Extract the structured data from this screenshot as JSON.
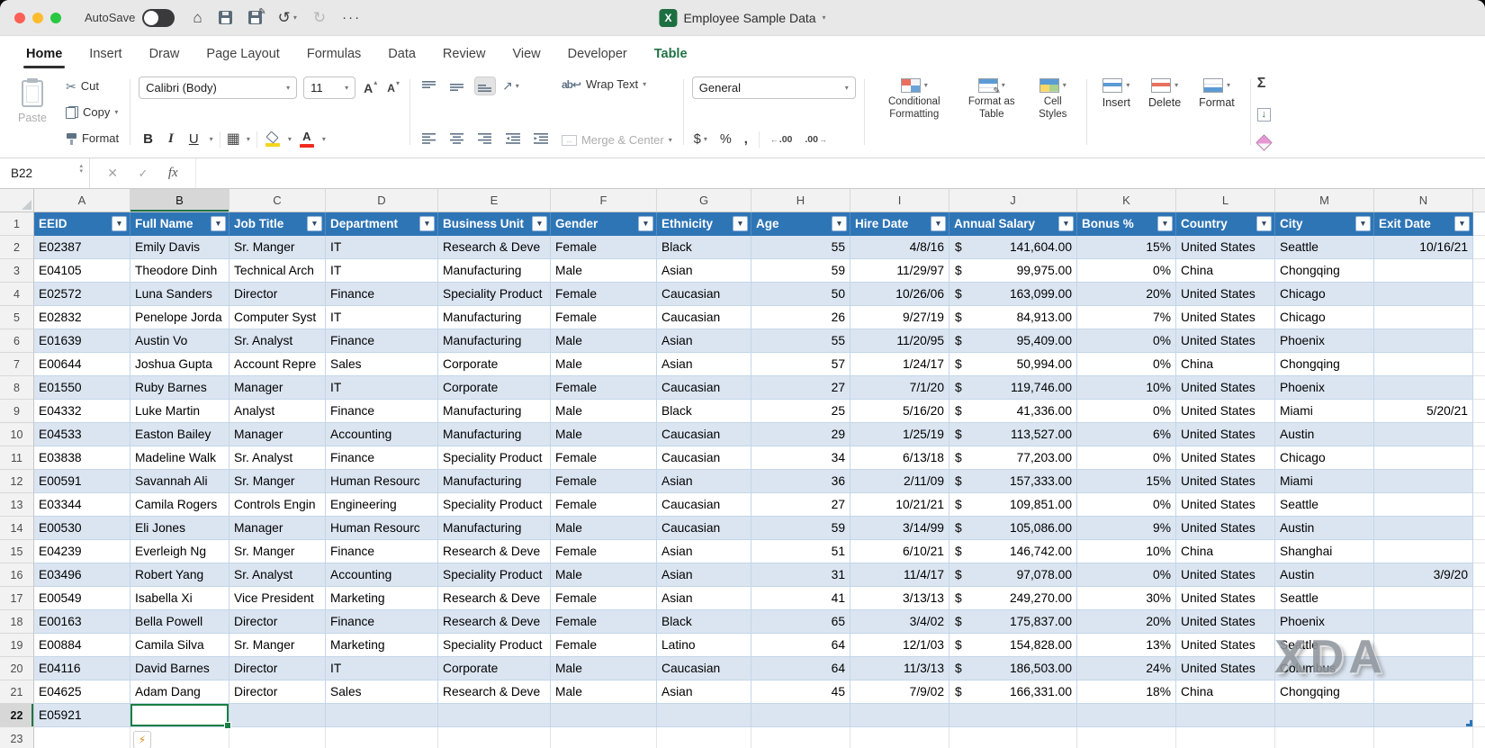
{
  "titlebar": {
    "autosave_label": "AutoSave",
    "doc_title": "Employee Sample Data"
  },
  "tabs": [
    {
      "label": "Home",
      "active": true
    },
    {
      "label": "Insert"
    },
    {
      "label": "Draw"
    },
    {
      "label": "Page Layout"
    },
    {
      "label": "Formulas"
    },
    {
      "label": "Data"
    },
    {
      "label": "Review"
    },
    {
      "label": "View"
    },
    {
      "label": "Developer"
    },
    {
      "label": "Table",
      "contextual": true
    }
  ],
  "ribbon": {
    "paste_label": "Paste",
    "cut_label": "Cut",
    "copy_label": "Copy",
    "format_painter_label": "Format",
    "font_name": "Calibri (Body)",
    "font_size": "11",
    "wrap_text_label": "Wrap Text",
    "merge_center_label": "Merge & Center",
    "number_format": "General",
    "conditional_formatting_label": "Conditional Formatting",
    "format_as_table_label": "Format as Table",
    "cell_styles_label": "Cell Styles",
    "insert_label": "Insert",
    "delete_label": "Delete",
    "format_label": "Format"
  },
  "formula_bar": {
    "name_box": "B22",
    "formula_value": ""
  },
  "sheet": {
    "selected_cell": "B22",
    "selected_column": "B",
    "selected_row": 22,
    "column_letters": [
      "A",
      "B",
      "C",
      "D",
      "E",
      "F",
      "G",
      "H",
      "I",
      "J",
      "K",
      "L",
      "M",
      "N"
    ],
    "table_headers": [
      "EEID",
      "Full Name",
      "Job Title",
      "Department",
      "Business Unit",
      "Gender",
      "Ethnicity",
      "Age",
      "Hire Date",
      "Annual Salary",
      "Bonus %",
      "Country",
      "City",
      "Exit Date"
    ],
    "rows": [
      {
        "n": 2,
        "cells": [
          "E02387",
          "Emily Davis",
          "Sr. Manger",
          "IT",
          "Research & Deve",
          "Female",
          "Black",
          "55",
          "4/8/16",
          "141,604.00",
          "15%",
          "United States",
          "Seattle",
          "10/16/21"
        ]
      },
      {
        "n": 3,
        "cells": [
          "E04105",
          "Theodore Dinh",
          "Technical Arch",
          "IT",
          "Manufacturing",
          "Male",
          "Asian",
          "59",
          "11/29/97",
          "99,975.00",
          "0%",
          "China",
          "Chongqing",
          ""
        ]
      },
      {
        "n": 4,
        "cells": [
          "E02572",
          "Luna Sanders",
          "Director",
          "Finance",
          "Speciality Product",
          "Female",
          "Caucasian",
          "50",
          "10/26/06",
          "163,099.00",
          "20%",
          "United States",
          "Chicago",
          ""
        ]
      },
      {
        "n": 5,
        "cells": [
          "E02832",
          "Penelope Jorda",
          "Computer Syst",
          "IT",
          "Manufacturing",
          "Female",
          "Caucasian",
          "26",
          "9/27/19",
          "84,913.00",
          "7%",
          "United States",
          "Chicago",
          ""
        ]
      },
      {
        "n": 6,
        "cells": [
          "E01639",
          "Austin Vo",
          "Sr. Analyst",
          "Finance",
          "Manufacturing",
          "Male",
          "Asian",
          "55",
          "11/20/95",
          "95,409.00",
          "0%",
          "United States",
          "Phoenix",
          ""
        ]
      },
      {
        "n": 7,
        "cells": [
          "E00644",
          "Joshua Gupta",
          "Account Repre",
          "Sales",
          "Corporate",
          "Male",
          "Asian",
          "57",
          "1/24/17",
          "50,994.00",
          "0%",
          "China",
          "Chongqing",
          ""
        ]
      },
      {
        "n": 8,
        "cells": [
          "E01550",
          "Ruby Barnes",
          "Manager",
          "IT",
          "Corporate",
          "Female",
          "Caucasian",
          "27",
          "7/1/20",
          "119,746.00",
          "10%",
          "United States",
          "Phoenix",
          ""
        ]
      },
      {
        "n": 9,
        "cells": [
          "E04332",
          "Luke Martin",
          "Analyst",
          "Finance",
          "Manufacturing",
          "Male",
          "Black",
          "25",
          "5/16/20",
          "41,336.00",
          "0%",
          "United States",
          "Miami",
          "5/20/21"
        ]
      },
      {
        "n": 10,
        "cells": [
          "E04533",
          "Easton Bailey",
          "Manager",
          "Accounting",
          "Manufacturing",
          "Male",
          "Caucasian",
          "29",
          "1/25/19",
          "113,527.00",
          "6%",
          "United States",
          "Austin",
          ""
        ]
      },
      {
        "n": 11,
        "cells": [
          "E03838",
          "Madeline Walk",
          "Sr. Analyst",
          "Finance",
          "Speciality Product",
          "Female",
          "Caucasian",
          "34",
          "6/13/18",
          "77,203.00",
          "0%",
          "United States",
          "Chicago",
          ""
        ]
      },
      {
        "n": 12,
        "cells": [
          "E00591",
          "Savannah Ali",
          "Sr. Manger",
          "Human Resourc",
          "Manufacturing",
          "Female",
          "Asian",
          "36",
          "2/11/09",
          "157,333.00",
          "15%",
          "United States",
          "Miami",
          ""
        ]
      },
      {
        "n": 13,
        "cells": [
          "E03344",
          "Camila Rogers",
          "Controls Engin",
          "Engineering",
          "Speciality Product",
          "Female",
          "Caucasian",
          "27",
          "10/21/21",
          "109,851.00",
          "0%",
          "United States",
          "Seattle",
          ""
        ]
      },
      {
        "n": 14,
        "cells": [
          "E00530",
          "Eli Jones",
          "Manager",
          "Human Resourc",
          "Manufacturing",
          "Male",
          "Caucasian",
          "59",
          "3/14/99",
          "105,086.00",
          "9%",
          "United States",
          "Austin",
          ""
        ]
      },
      {
        "n": 15,
        "cells": [
          "E04239",
          "Everleigh Ng",
          "Sr. Manger",
          "Finance",
          "Research & Deve",
          "Female",
          "Asian",
          "51",
          "6/10/21",
          "146,742.00",
          "10%",
          "China",
          "Shanghai",
          ""
        ]
      },
      {
        "n": 16,
        "cells": [
          "E03496",
          "Robert Yang",
          "Sr. Analyst",
          "Accounting",
          "Speciality Product",
          "Male",
          "Asian",
          "31",
          "11/4/17",
          "97,078.00",
          "0%",
          "United States",
          "Austin",
          "3/9/20"
        ]
      },
      {
        "n": 17,
        "cells": [
          "E00549",
          "Isabella Xi",
          "Vice President",
          "Marketing",
          "Research & Deve",
          "Female",
          "Asian",
          "41",
          "3/13/13",
          "249,270.00",
          "30%",
          "United States",
          "Seattle",
          ""
        ]
      },
      {
        "n": 18,
        "cells": [
          "E00163",
          "Bella Powell",
          "Director",
          "Finance",
          "Research & Deve",
          "Female",
          "Black",
          "65",
          "3/4/02",
          "175,837.00",
          "20%",
          "United States",
          "Phoenix",
          ""
        ]
      },
      {
        "n": 19,
        "cells": [
          "E00884",
          "Camila Silva",
          "Sr. Manger",
          "Marketing",
          "Speciality Product",
          "Female",
          "Latino",
          "64",
          "12/1/03",
          "154,828.00",
          "13%",
          "United States",
          "Seattle",
          ""
        ]
      },
      {
        "n": 20,
        "cells": [
          "E04116",
          "David Barnes",
          "Director",
          "IT",
          "Corporate",
          "Male",
          "Caucasian",
          "64",
          "11/3/13",
          "186,503.00",
          "24%",
          "United States",
          "Columbus",
          ""
        ]
      },
      {
        "n": 21,
        "cells": [
          "E04625",
          "Adam Dang",
          "Director",
          "Sales",
          "Research & Deve",
          "Male",
          "Asian",
          "45",
          "7/9/02",
          "166,331.00",
          "18%",
          "China",
          "Chongqing",
          ""
        ]
      },
      {
        "n": 22,
        "cells": [
          "E05921",
          "",
          "",
          "",
          "",
          "",
          "",
          "",
          "",
          "",
          "",
          "",
          "",
          ""
        ]
      }
    ]
  },
  "watermark": "XDA",
  "colors": {
    "accent_green": "#217346",
    "table_header_blue": "#2e75b6",
    "band_blue": "#dbe5f1"
  }
}
